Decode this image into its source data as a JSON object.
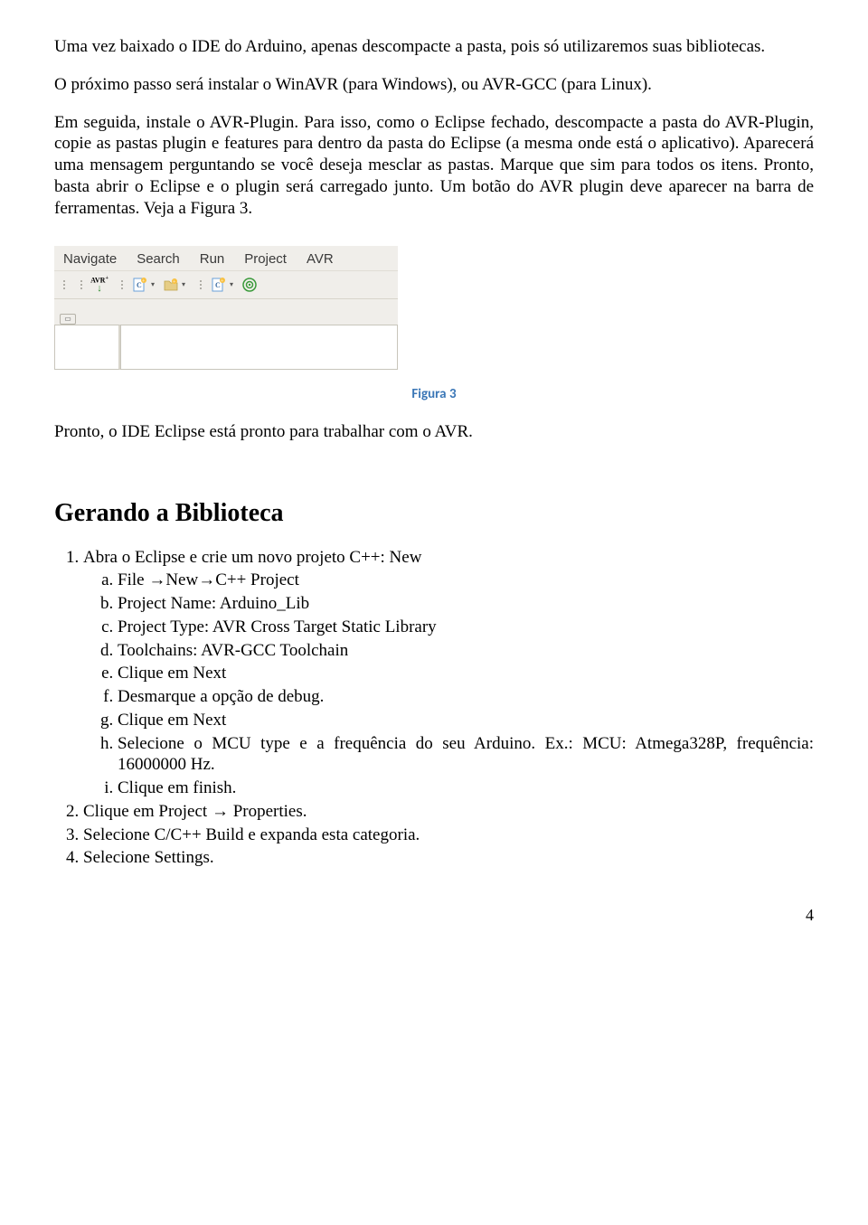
{
  "para1": "Uma vez baixado o IDE do Arduino, apenas descompacte a pasta, pois só utilizaremos suas bibliotecas.",
  "para2": "O próximo passo será instalar o WinAVR (para Windows), ou AVR-GCC (para Linux).",
  "para3": "Em seguida, instale o AVR-Plugin. Para isso, como o Eclipse fechado, descompacte a pasta do AVR-Plugin, copie as pastas plugin e features para dentro da pasta do Eclipse (a mesma onde está o aplicativo). Aparecerá uma mensagem perguntando se você deseja mesclar as pastas. Marque que sim para todos os itens. Pronto, basta abrir o Eclipse e o plugin será carregado junto. Um botão do AVR plugin deve aparecer na barra de ferramentas. Veja a Figura 3.",
  "figure": {
    "menus": [
      "Navigate",
      "Search",
      "Run",
      "Project",
      "AVR"
    ],
    "avr_label": "AVR",
    "caption": "Figura 3"
  },
  "para4": "Pronto, o IDE Eclipse está pronto para trabalhar com o AVR.",
  "section_heading": "Gerando a Biblioteca",
  "steps": {
    "s1": "Abra o Eclipse e crie um novo projeto C++: New",
    "s1a_pre": "File",
    "s1a_mid": "New",
    "s1a_post": "C++ Project",
    "s1b": "Project Name: Arduino_Lib",
    "s1c": "Project Type: AVR Cross Target Static Library",
    "s1d": "Toolchains: AVR-GCC Toolchain",
    "s1e": "Clique em Next",
    "s1f": "Desmarque a opção de debug.",
    "s1g": "Clique em Next",
    "s1h": "Selecione o MCU type  e a frequência do seu Arduino. Ex.: MCU: Atmega328P, frequência: 16000000 Hz.",
    "s1i": "Clique em finish.",
    "s2_pre": "Clique em Project ",
    "s2_post": " Properties.",
    "s3": "Selecione C/C++ Build e expanda esta categoria.",
    "s4": "Selecione Settings."
  },
  "page_number": "4"
}
